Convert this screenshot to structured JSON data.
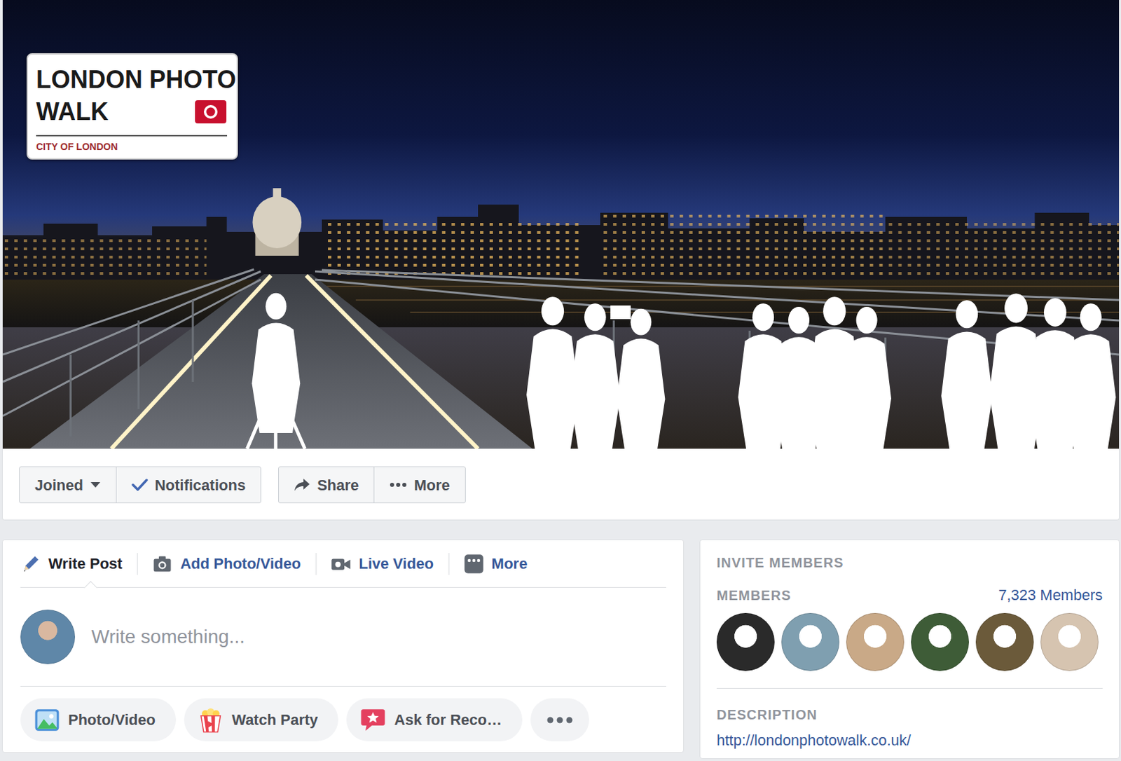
{
  "cover": {
    "sign": {
      "lines": [
        "LONDON PHOTO",
        "WALK"
      ],
      "subtitle": "CITY OF LONDON"
    }
  },
  "group_actions": [
    [
      {
        "label": "Joined",
        "kind": "dropdown"
      },
      {
        "label": "Notifications",
        "kind": "toggle",
        "on": true
      }
    ],
    [
      {
        "label": "Share",
        "kind": "share"
      },
      {
        "label": "More",
        "kind": "more"
      }
    ]
  ],
  "composer": {
    "tabs": [
      {
        "label": "Write Post",
        "kind": "write",
        "selected": true
      },
      {
        "label": "Add Photo/Video",
        "kind": "photo",
        "selected": false
      },
      {
        "label": "Live Video",
        "kind": "live",
        "selected": false
      },
      {
        "label": "More",
        "kind": "more",
        "selected": false
      }
    ],
    "placeholder": "Write something...",
    "quick_actions": [
      {
        "label": "Photo/Video",
        "kind": "photo"
      },
      {
        "label": "Watch Party",
        "kind": "party"
      },
      {
        "label": "Ask for Reco…",
        "kind": "recommend"
      }
    ]
  },
  "sidebar": {
    "invite_label": "INVITE MEMBERS",
    "members_label": "MEMBERS",
    "members_count": "7,323 Members",
    "member_avatars": [
      {
        "color": "#2a2a2a"
      },
      {
        "color": "#7f9fb0"
      },
      {
        "color": "#c9a987"
      },
      {
        "color": "#3e5c37"
      },
      {
        "color": "#6b5a3a"
      },
      {
        "color": "#d6c4b0"
      }
    ],
    "description_label": "DESCRIPTION",
    "description": "http://londonphotowalk.co.uk/"
  }
}
